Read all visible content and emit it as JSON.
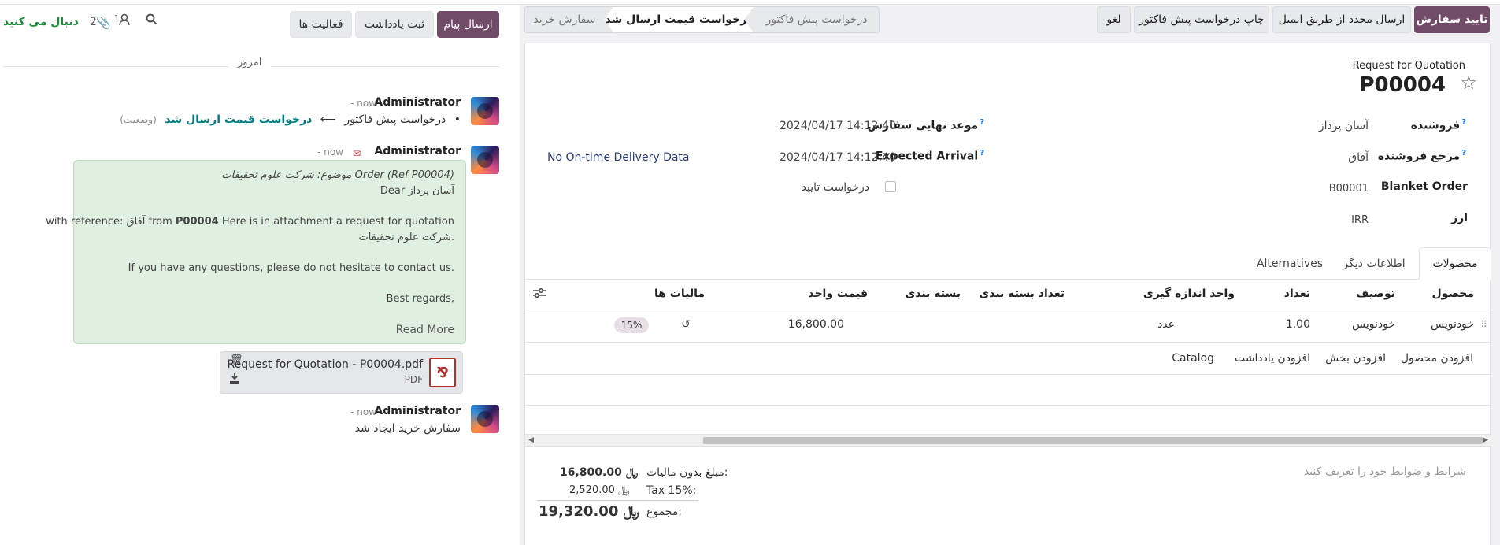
{
  "header": {
    "confirm": "تایید سفارش",
    "resend_email": "ارسال مجدد از طریق ایمیل",
    "print_rfq": "چاپ درخواست پیش فاکتور",
    "cancel": "لغو"
  },
  "stages": [
    "درخواست پیش فاکتور",
    "درخواست قیمت ارسال شد",
    "سفارش خرید"
  ],
  "chatter": {
    "send_message": "ارسال پیام",
    "log_note": "ثبت یادداشت",
    "activities": "فعالیت ها",
    "follow": "دنبال می کنید",
    "followers_count": "1",
    "attachments_count": "2",
    "today": "امروز",
    "messages": [
      {
        "author": "Administrator",
        "time": "now",
        "change_from": "درخواست پیش فاکتور",
        "arrow": "⟵",
        "change_to": "درخواست قیمت ارسال شد",
        "field": "(وضعیت)"
      },
      {
        "author": "Administrator",
        "time": "now",
        "subject": "موضوع: شرکت علوم تحقیقات Order (Ref P00004)",
        "dear": "Dear آسان پرداز",
        "body_1": "Here is in attachment a request for quotation",
        "body_ref": "P00004",
        "body_2": "with reference: آفاق from",
        "body_3": "شرکت علوم تحقیقات.",
        "body_4": "If you have any questions, please do not hesitate to contact us.",
        "body_5": "Best regards,",
        "read_more": "Read More"
      },
      {
        "author": "Administrator",
        "time": "now",
        "text": "سفارش خرید ایجاد شد"
      }
    ],
    "attachment": {
      "name": "Request for Quotation - P00004.pdf",
      "type": "PDF"
    }
  },
  "form": {
    "doc_type": "Request for Quotation",
    "name": "P00004",
    "vendor_label": "فروشنده",
    "vendor": "آسان پرداز",
    "vendor_ref_label": "مرجع فروشنده",
    "vendor_ref": "آفاق",
    "blanket_label": "Blanket Order",
    "blanket": "B00001",
    "currency_label": "ارز",
    "currency": "IRR",
    "deadline_label": "موعد نهایی سفارش",
    "deadline": "2024/04/17 14:12:40",
    "arrival_label": "Expected Arrival",
    "arrival": "2024/04/17 14:12:40",
    "ack_label": "درخواست تایید",
    "ontime": "No On-time Delivery Data"
  },
  "tabs": [
    "محصولات",
    "اطلاعات دیگر",
    "Alternatives"
  ],
  "table": {
    "headers": [
      "محصول",
      "توصیف",
      "تعداد",
      "واحد اندازه گیری",
      "تعداد بسته بندی",
      "بسته بندی",
      "قیمت واحد",
      "مالیات ها"
    ],
    "rows": [
      {
        "product": "خودنویس",
        "desc": "خودنویس",
        "qty": "1.00",
        "uom": "عدد",
        "price": "16,800.00",
        "tax": "15%"
      }
    ],
    "add_product": "افزودن محصول",
    "add_section": "افزودن بخش",
    "add_note": "افزودن یادداشت",
    "catalog": "Catalog"
  },
  "terms_placeholder": "شرایط و ضوابط خود را تعریف کنید",
  "totals": {
    "untaxed_label": "مبلغ بدون مالیات:",
    "untaxed": "16,800.00 ﷼",
    "tax_label": "Tax 15%:",
    "tax": "2,520.00 ﷼",
    "total_label": "مجموع:",
    "total": "19,320.00 ﷼"
  }
}
